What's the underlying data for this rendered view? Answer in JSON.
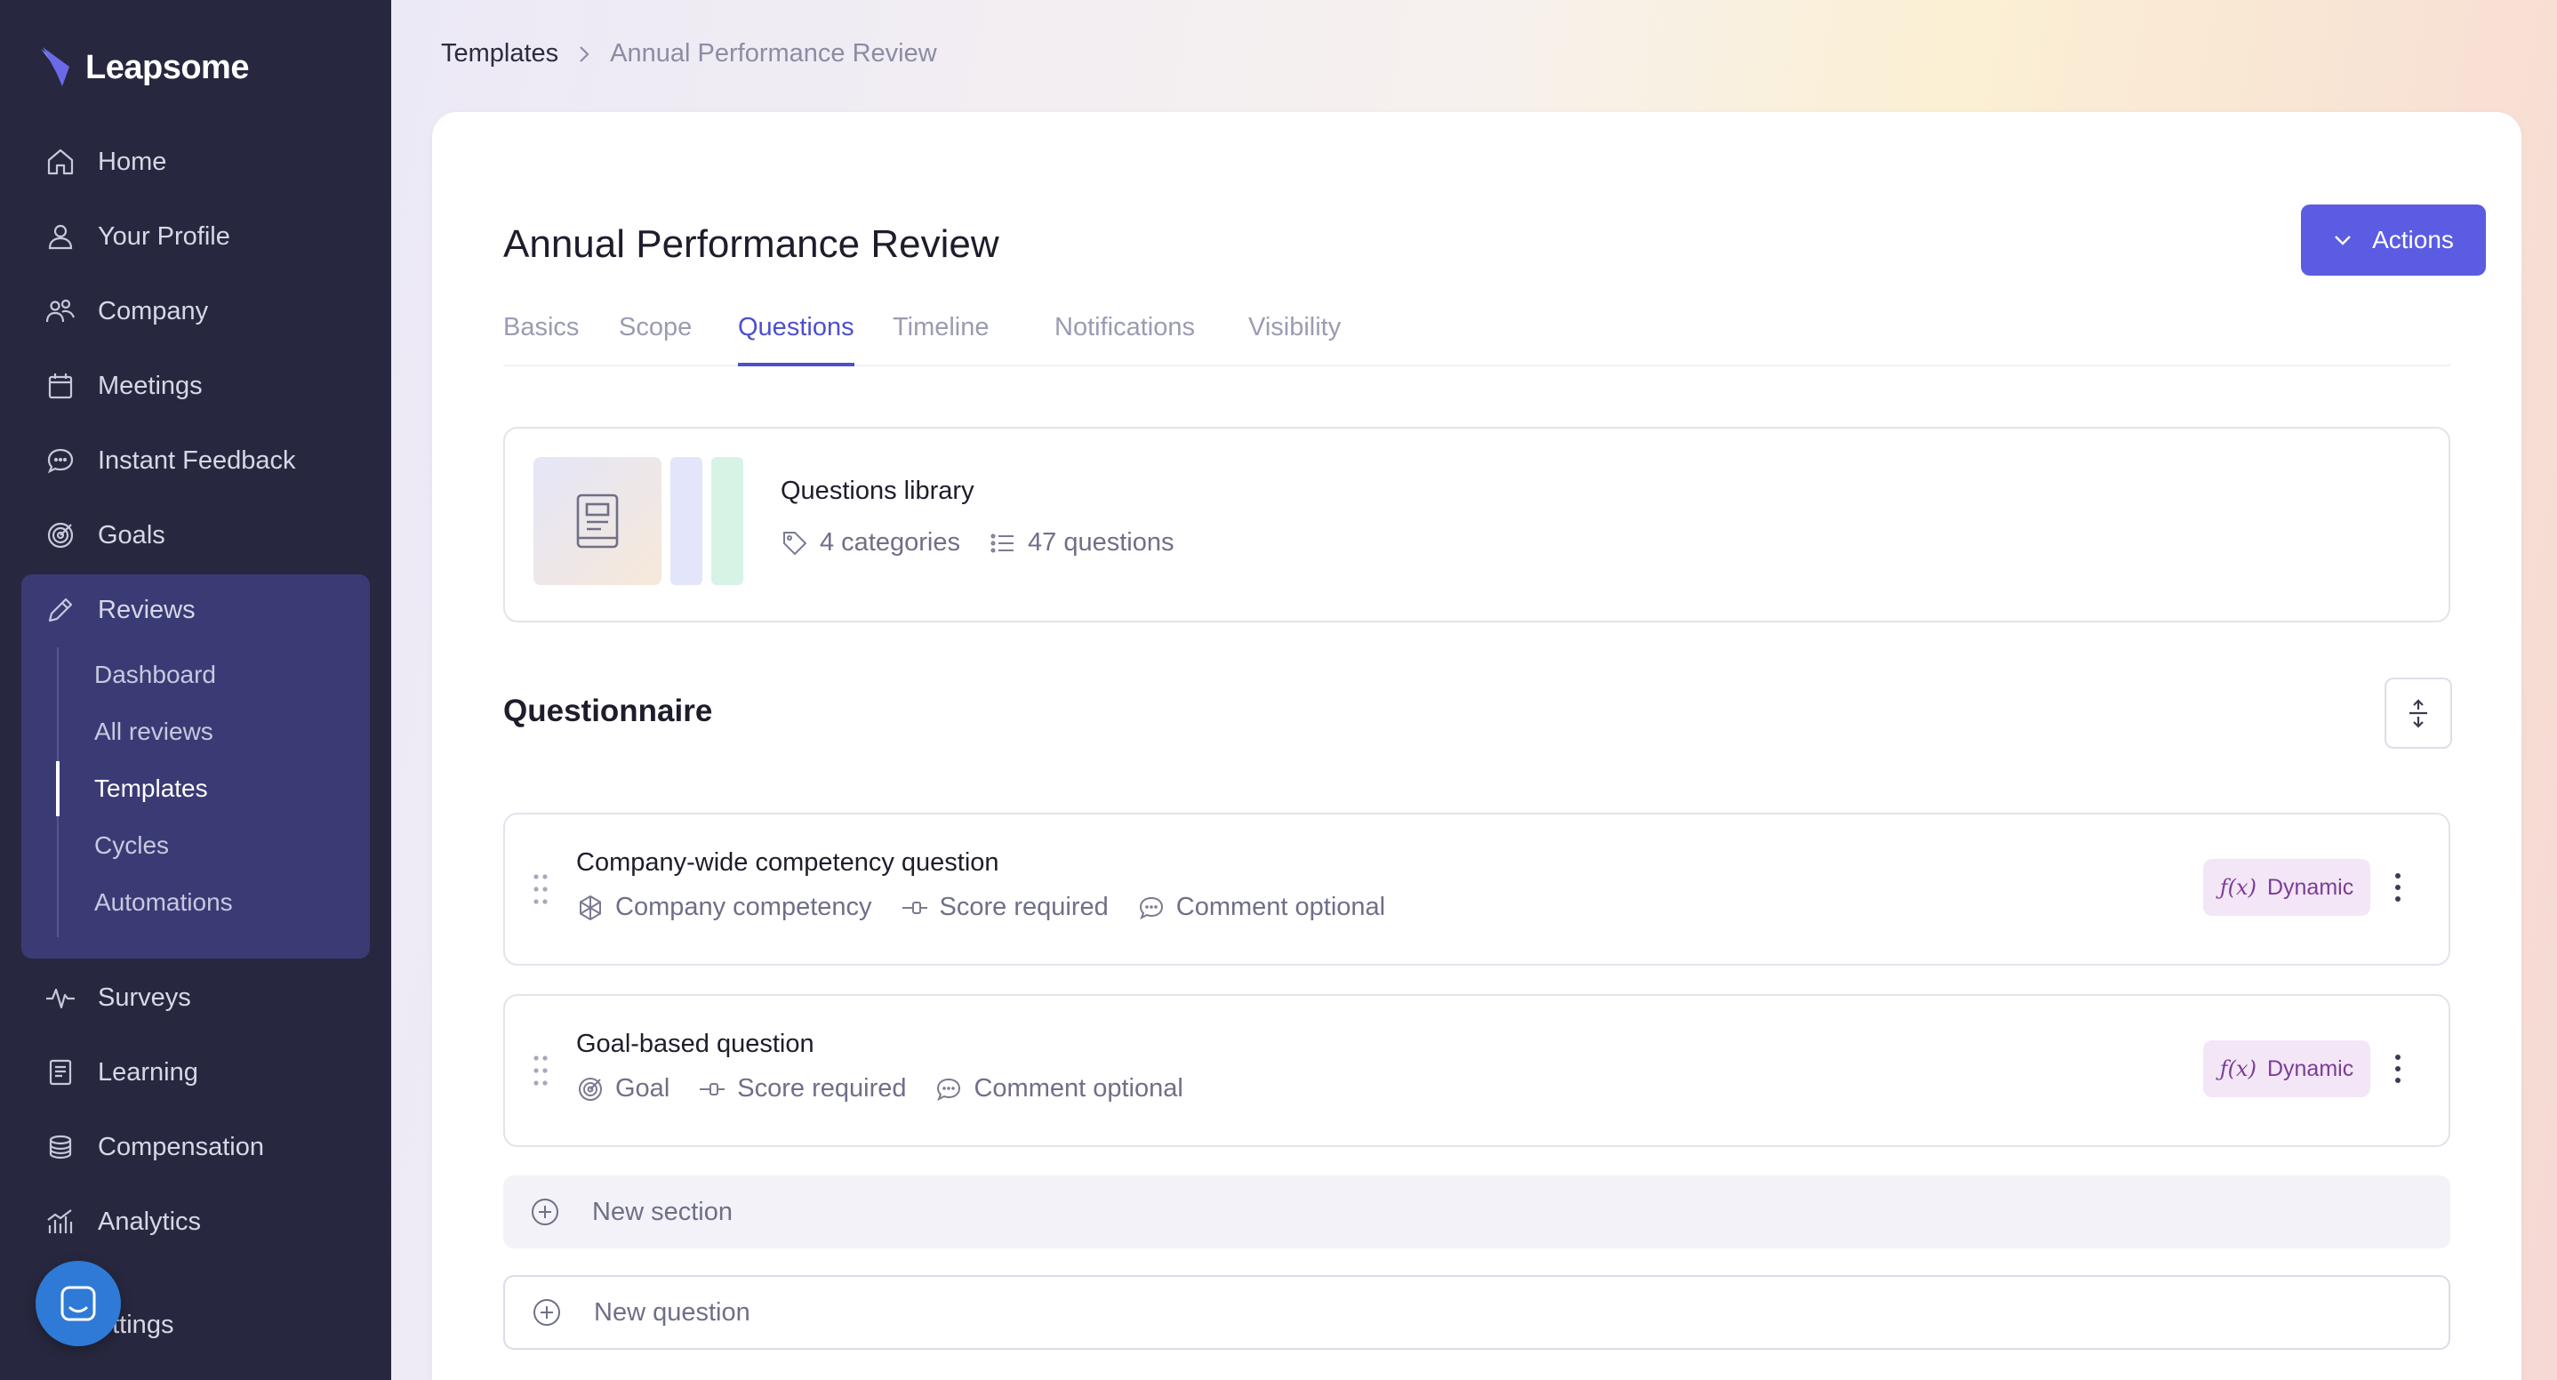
{
  "app": {
    "name": "Leapsome"
  },
  "sidebar": {
    "items": [
      {
        "label": "Home",
        "icon": "home-icon"
      },
      {
        "label": "Your Profile",
        "icon": "user-icon"
      },
      {
        "label": "Company",
        "icon": "people-icon"
      },
      {
        "label": "Meetings",
        "icon": "calendar-icon"
      },
      {
        "label": "Instant Feedback",
        "icon": "chat-icon"
      },
      {
        "label": "Goals",
        "icon": "target-icon"
      },
      {
        "label": "Reviews",
        "icon": "pencil-icon"
      },
      {
        "label": "Surveys",
        "icon": "pulse-icon"
      },
      {
        "label": "Learning",
        "icon": "book-icon"
      },
      {
        "label": "Compensation",
        "icon": "coins-icon"
      },
      {
        "label": "Analytics",
        "icon": "bar-chart-icon"
      },
      {
        "label": "Settings",
        "icon": "gear-icon"
      }
    ],
    "reviews_sub": [
      {
        "label": "Dashboard"
      },
      {
        "label": "All reviews"
      },
      {
        "label": "Templates",
        "active": true
      },
      {
        "label": "Cycles"
      },
      {
        "label": "Automations"
      }
    ],
    "settings_visible": "ettings"
  },
  "breadcrumb": {
    "parent": "Templates",
    "current": "Annual Performance Review"
  },
  "page": {
    "title": "Annual Performance Review",
    "actions_label": "Actions",
    "tabs": [
      "Basics",
      "Scope",
      "Questions",
      "Timeline",
      "Notifications",
      "Visibility"
    ],
    "active_tab": "Questions"
  },
  "library": {
    "title": "Questions library",
    "categories": "4 categories",
    "questions": "47 questions"
  },
  "questionnaire": {
    "heading": "Questionnaire",
    "questions": [
      {
        "title": "Company-wide competency question",
        "type": "Company competency",
        "score": "Score required",
        "comment": "Comment optional",
        "badge": "Dynamic"
      },
      {
        "title": "Goal-based question",
        "type": "Goal",
        "score": "Score required",
        "comment": "Comment optional",
        "badge": "Dynamic"
      }
    ],
    "new_section": "New section",
    "new_question": "New question"
  },
  "colors": {
    "sidebar_bg": "#27283f",
    "reviews_group_bg": "#3a3b74",
    "accent": "#5b5ce2",
    "badge_bg": "#f3e6f7",
    "badge_text": "#7a3d96"
  }
}
